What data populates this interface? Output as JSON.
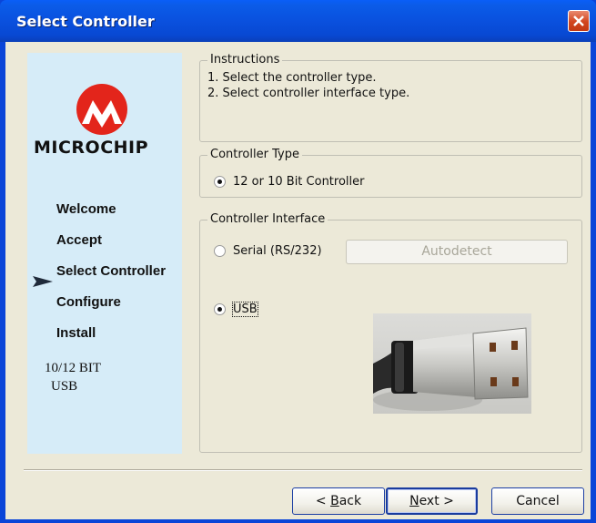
{
  "window": {
    "title": "Select Controller"
  },
  "sidebar": {
    "brand": "MICROCHIP",
    "steps": [
      {
        "label": "Welcome",
        "current": false
      },
      {
        "label": "Accept",
        "current": false
      },
      {
        "label": "Select Controller",
        "current": true
      },
      {
        "label": "Configure",
        "current": false
      },
      {
        "label": "Install",
        "current": false
      }
    ],
    "info_line1": "10/12 BIT",
    "info_line2": "USB"
  },
  "instructions": {
    "legend": "Instructions",
    "line1": "1. Select the controller type.",
    "line2": "2. Select controller interface type."
  },
  "controller_type": {
    "legend": "Controller Type",
    "option": "12 or 10 Bit Controller",
    "selected": true
  },
  "controller_interface": {
    "legend": "Controller Interface",
    "serial_label": "Serial (RS/232)",
    "serial_selected": false,
    "autodetect_label": "Autodetect",
    "autodetect_enabled": false,
    "usb_label": "USB",
    "usb_selected": true
  },
  "footer": {
    "back_label": "Back",
    "back_mnemonic": "B",
    "back_rest": "ack",
    "back_prefix": "< ",
    "next_mnemonic": "N",
    "next_rest": "ext",
    "next_suffix": " >",
    "next_label": "Next >",
    "cancel_label": "Cancel"
  },
  "colors": {
    "title_bar": "#0a52e0",
    "sidebar": "#d6ecf8",
    "dialog": "#ece9d8",
    "microchip_red": "#e3251b"
  }
}
